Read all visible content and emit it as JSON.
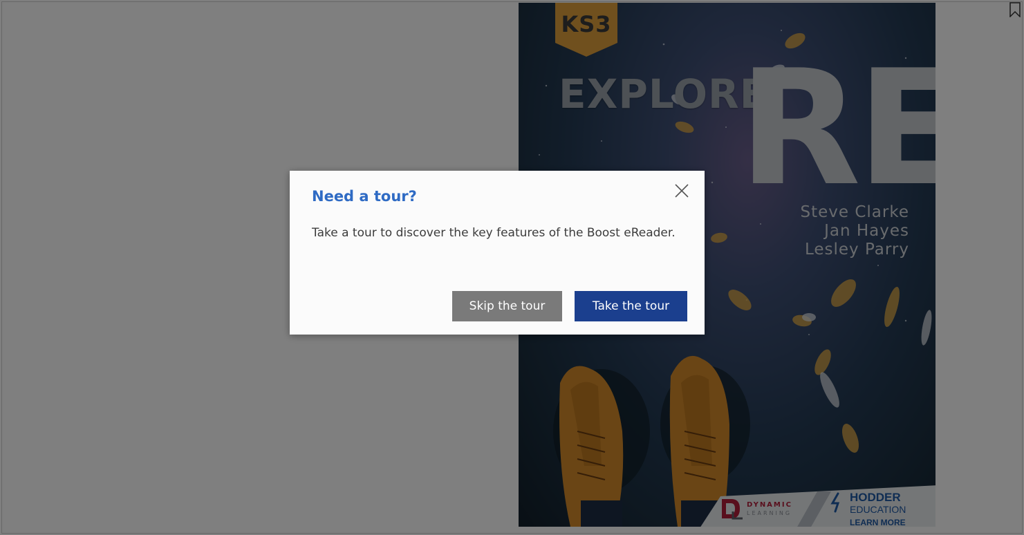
{
  "cover": {
    "badge": "KS3",
    "title_word": "EXPLORE",
    "title_main": "RE",
    "authors": [
      "Steve Clarke",
      "Jan Hayes",
      "Lesley Parry"
    ],
    "publisher_1_line1": "DYNAMIC",
    "publisher_1_line2": "LEARNING",
    "publisher_2_name": "HODDER",
    "publisher_2_sub": "EDUCATION",
    "publisher_2_link": "LEARN MORE"
  },
  "modal": {
    "title": "Need a tour?",
    "body": "Take a tour to discover the key features of the Boost eReader.",
    "skip_label": "Skip the tour",
    "take_label": "Take the tour",
    "close_icon": "close-icon"
  },
  "toolbar": {
    "bookmark_icon": "bookmark-icon"
  },
  "colors": {
    "modal_title": "#2f6bc4",
    "skip_button": "#7a7a7a",
    "take_button": "#1b3f8e",
    "badge": "#e0a03c"
  }
}
